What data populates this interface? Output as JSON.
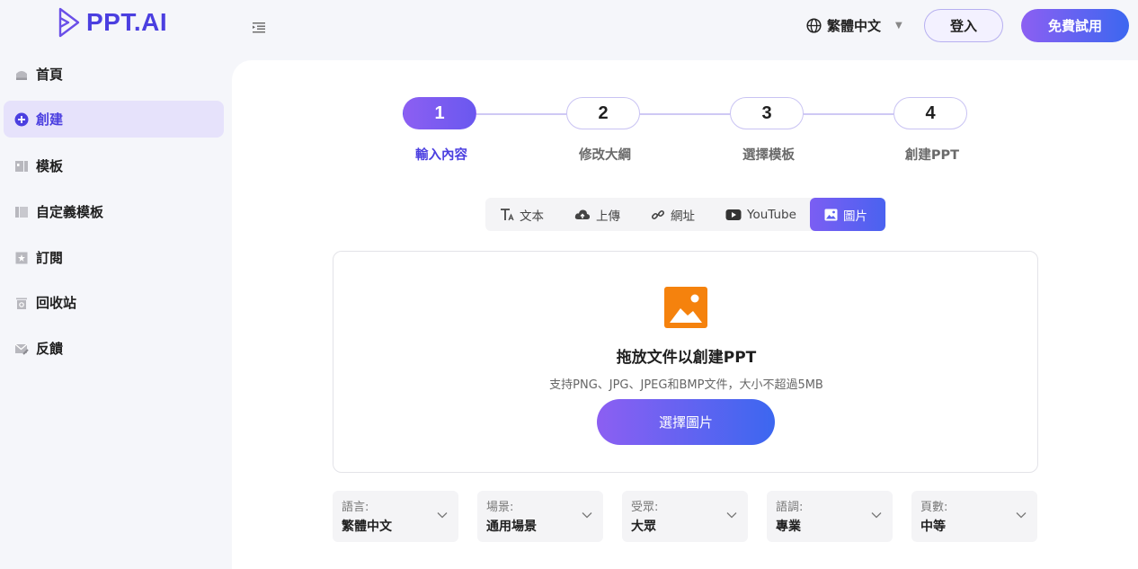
{
  "header": {
    "logo_text": "PPT.AI",
    "language_label": "繁體中文",
    "login_label": "登入",
    "trial_label": "免費試用"
  },
  "sidebar": {
    "items": [
      {
        "label": "首頁",
        "icon": "home-icon"
      },
      {
        "label": "創建",
        "icon": "plus-circle-icon",
        "active": true
      },
      {
        "label": "模板",
        "icon": "template-icon"
      },
      {
        "label": "自定義模板",
        "icon": "custom-template-icon"
      },
      {
        "label": "訂閱",
        "icon": "subscription-icon"
      },
      {
        "label": "回收站",
        "icon": "trash-icon"
      },
      {
        "label": "反饋",
        "icon": "feedback-icon"
      }
    ]
  },
  "steps": [
    {
      "number": "1",
      "label": "輸入內容",
      "active": true
    },
    {
      "number": "2",
      "label": "修改大綱"
    },
    {
      "number": "3",
      "label": "選擇模板"
    },
    {
      "number": "4",
      "label": "創建PPT"
    }
  ],
  "tabs": [
    {
      "label": "文本",
      "icon": "text-icon"
    },
    {
      "label": "上傳",
      "icon": "cloud-upload-icon"
    },
    {
      "label": "網址",
      "icon": "link-icon"
    },
    {
      "label": "YouTube",
      "icon": "youtube-icon"
    },
    {
      "label": "圖片",
      "icon": "image-icon",
      "active": true
    }
  ],
  "dropzone": {
    "title": "拖放文件以創建PPT",
    "subtitle": "支持PNG、JPG、JPEG和BMP文件，大小不超過5MB",
    "button_label": "選擇圖片"
  },
  "options": [
    {
      "label": "語言:",
      "value": "繁體中文"
    },
    {
      "label": "場景:",
      "value": "通用場景"
    },
    {
      "label": "受眾:",
      "value": "大眾"
    },
    {
      "label": "語調:",
      "value": "專業"
    },
    {
      "label": "頁數:",
      "value": "中等"
    }
  ],
  "colors": {
    "accent": "#4b3fe0",
    "gradient_start": "#8c5ff2",
    "gradient_end": "#3c67f0",
    "image_icon": "#f5820d"
  }
}
